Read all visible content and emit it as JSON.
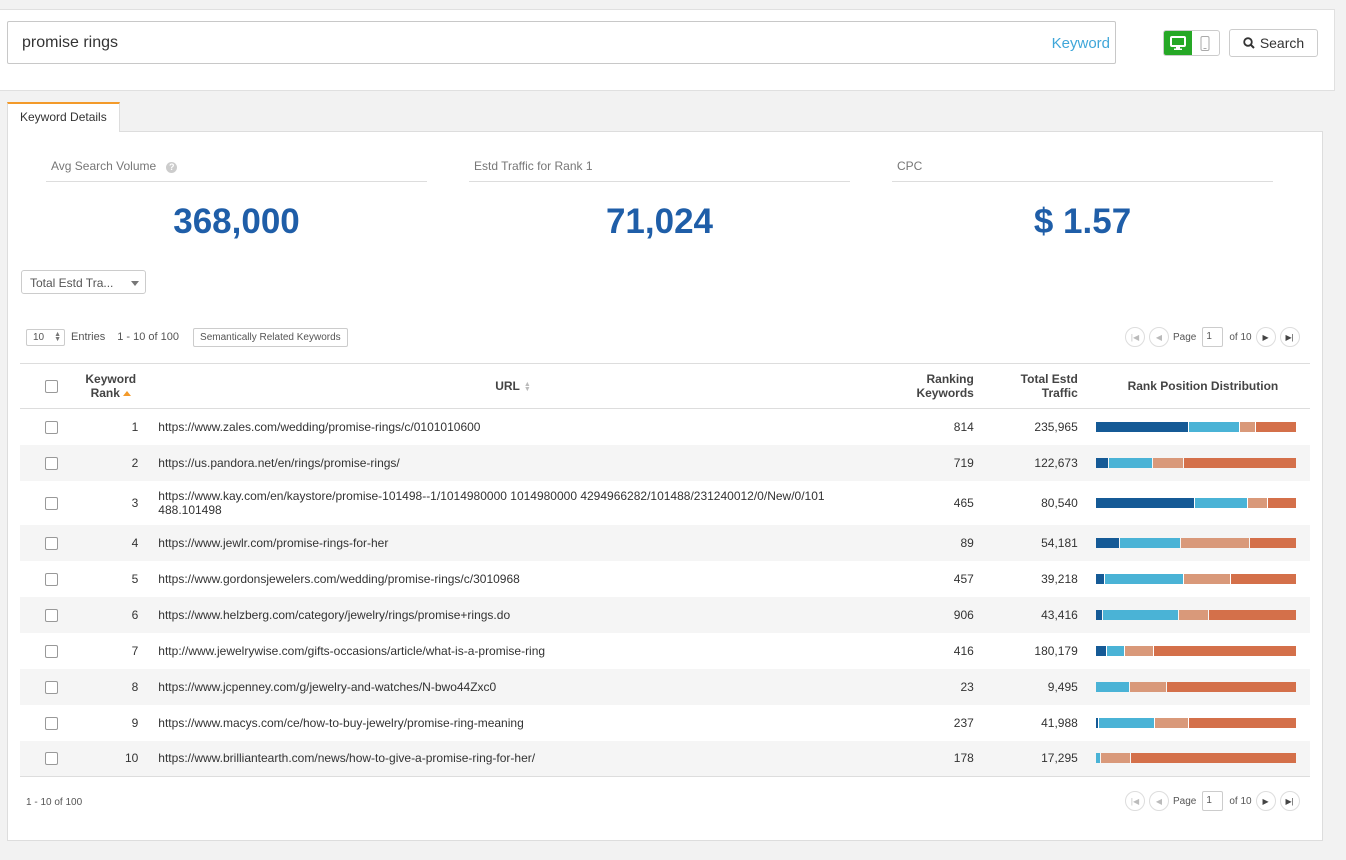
{
  "search": {
    "value": "promise rings",
    "type_label": "Keyword",
    "button_label": "Search"
  },
  "tabs": [
    {
      "label": "Keyword Details",
      "active": true
    }
  ],
  "metrics": [
    {
      "label": "Avg Search Volume",
      "value": "368,000"
    },
    {
      "label": "Estd Traffic for Rank 1",
      "value": "71,024"
    },
    {
      "label": "CPC",
      "value": "$ 1.57"
    }
  ],
  "dropdown": {
    "selected": "Total Estd Tra..."
  },
  "toolbar": {
    "entries_value": "10",
    "entries_label": "Entries",
    "range": "1 - 10 of 100",
    "semantic_button": "Semantically Related Keywords"
  },
  "pager": {
    "page_label": "Page",
    "page_value": "1",
    "of_label": "of 10"
  },
  "footer": {
    "range": "1 - 10 of 100"
  },
  "colors": {
    "rank_1_3": "#155a96",
    "rank_4_10": "#4ab3d6",
    "rank_11_20": "#d9997a",
    "rank_21_plus": "#d4704a",
    "accent": "#f39a2a",
    "metric_value": "#1f5ea8",
    "device_active": "#26a826"
  },
  "table": {
    "headers": {
      "rank": [
        "Keyword",
        "Rank"
      ],
      "url": "URL",
      "ranking_keywords": [
        "Ranking",
        "Keywords"
      ],
      "traffic": [
        "Total Estd",
        "Traffic"
      ],
      "distribution": "Rank Position Distribution"
    },
    "rows": [
      {
        "rank": "1",
        "url": "https://www.zales.com/wedding/promise-rings/c/0101010600",
        "ranking_keywords": "814",
        "traffic": "235,965",
        "dist": [
          0.47,
          0.25,
          0.08,
          0.2
        ]
      },
      {
        "rank": "2",
        "url": "https://us.pandora.net/en/rings/promise-rings/",
        "ranking_keywords": "719",
        "traffic": "122,673",
        "dist": [
          0.06,
          0.22,
          0.15,
          0.57
        ]
      },
      {
        "rank": "3",
        "url": "https://www.kay.com/en/kaystore/promise-101498--1/1014980000 1014980000 4294966282/101488/231240012/0/New/0/101 488.101498",
        "ranking_keywords": "465",
        "traffic": "80,540",
        "dist": [
          0.5,
          0.26,
          0.1,
          0.14
        ]
      },
      {
        "rank": "4",
        "url": "https://www.jewlr.com/promise-rings-for-her",
        "ranking_keywords": "89",
        "traffic": "54,181",
        "dist": [
          0.12,
          0.3,
          0.35,
          0.23
        ]
      },
      {
        "rank": "5",
        "url": "https://www.gordonsjewelers.com/wedding/promise-rings/c/3010968",
        "ranking_keywords": "457",
        "traffic": "39,218",
        "dist": [
          0.04,
          0.4,
          0.23,
          0.33
        ]
      },
      {
        "rank": "6",
        "url": "https://www.helzberg.com/category/jewelry/rings/promise+rings.do",
        "ranking_keywords": "906",
        "traffic": "43,416",
        "dist": [
          0.03,
          0.38,
          0.15,
          0.44
        ]
      },
      {
        "rank": "7",
        "url": "http://www.jewelrywise.com/gifts-occasions/article/what-is-a-promise-ring",
        "ranking_keywords": "416",
        "traffic": "180,179",
        "dist": [
          0.05,
          0.09,
          0.14,
          0.72
        ]
      },
      {
        "rank": "8",
        "url": "https://www.jcpenney.com/g/jewelry-and-watches/N-bwo44Zxc0",
        "ranking_keywords": "23",
        "traffic": "9,495",
        "dist": [
          0,
          0.17,
          0.18,
          0.65
        ]
      },
      {
        "rank": "9",
        "url": "https://www.macys.com/ce/how-to-buy-jewelry/promise-ring-meaning",
        "ranking_keywords": "237",
        "traffic": "41,988",
        "dist": [
          0.01,
          0.28,
          0.17,
          0.54
        ]
      },
      {
        "rank": "10",
        "url": "https://www.brilliantearth.com/news/how-to-give-a-promise-ring-for-her/",
        "ranking_keywords": "178",
        "traffic": "17,295",
        "dist": [
          0,
          0.02,
          0.15,
          0.83
        ]
      }
    ]
  }
}
